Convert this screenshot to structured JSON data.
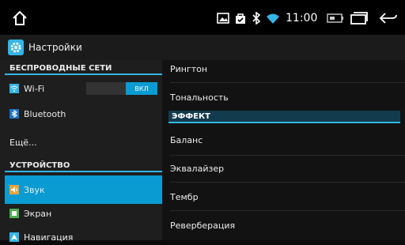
{
  "statusbar": {
    "time": "11:00",
    "icons": [
      "image-icon",
      "bag-icon",
      "bluetooth-icon",
      "wifi-icon",
      "battery-icon"
    ]
  },
  "navbar": {
    "buttons": [
      "home-icon",
      "recent-apps-icon",
      "back-icon"
    ]
  },
  "app": {
    "title": "Настройки",
    "icon": "settings-icon"
  },
  "left": {
    "sections": [
      {
        "header": "БЕСПРОВОДНЫЕ СЕТИ",
        "items": [
          {
            "label": "Wi-Fi",
            "icon": "wifi-icon",
            "toggle": "ВКЛ"
          },
          {
            "label": "Bluetooth",
            "icon": "bluetooth-icon"
          },
          {
            "label": "Ещё..."
          }
        ]
      },
      {
        "header": "УСТРОЙСТВО",
        "items": [
          {
            "label": "Звук",
            "icon": "sound-icon",
            "selected": true
          },
          {
            "label": "Экран",
            "icon": "display-icon"
          },
          {
            "label": "Навигация",
            "icon": "navigation-icon"
          }
        ]
      }
    ]
  },
  "right": {
    "items_top": [
      "Рингтон",
      "Тональность"
    ],
    "section": "ЭФФЕКТ",
    "items_bottom": [
      "Баланс",
      "Эквалайзер",
      "Тембр",
      "Реверберация"
    ]
  },
  "colors": {
    "accent": "#33b5e5",
    "selected": "#0a9bd3",
    "panel_left": "#1e1e1e",
    "panel_right": "#121212"
  }
}
